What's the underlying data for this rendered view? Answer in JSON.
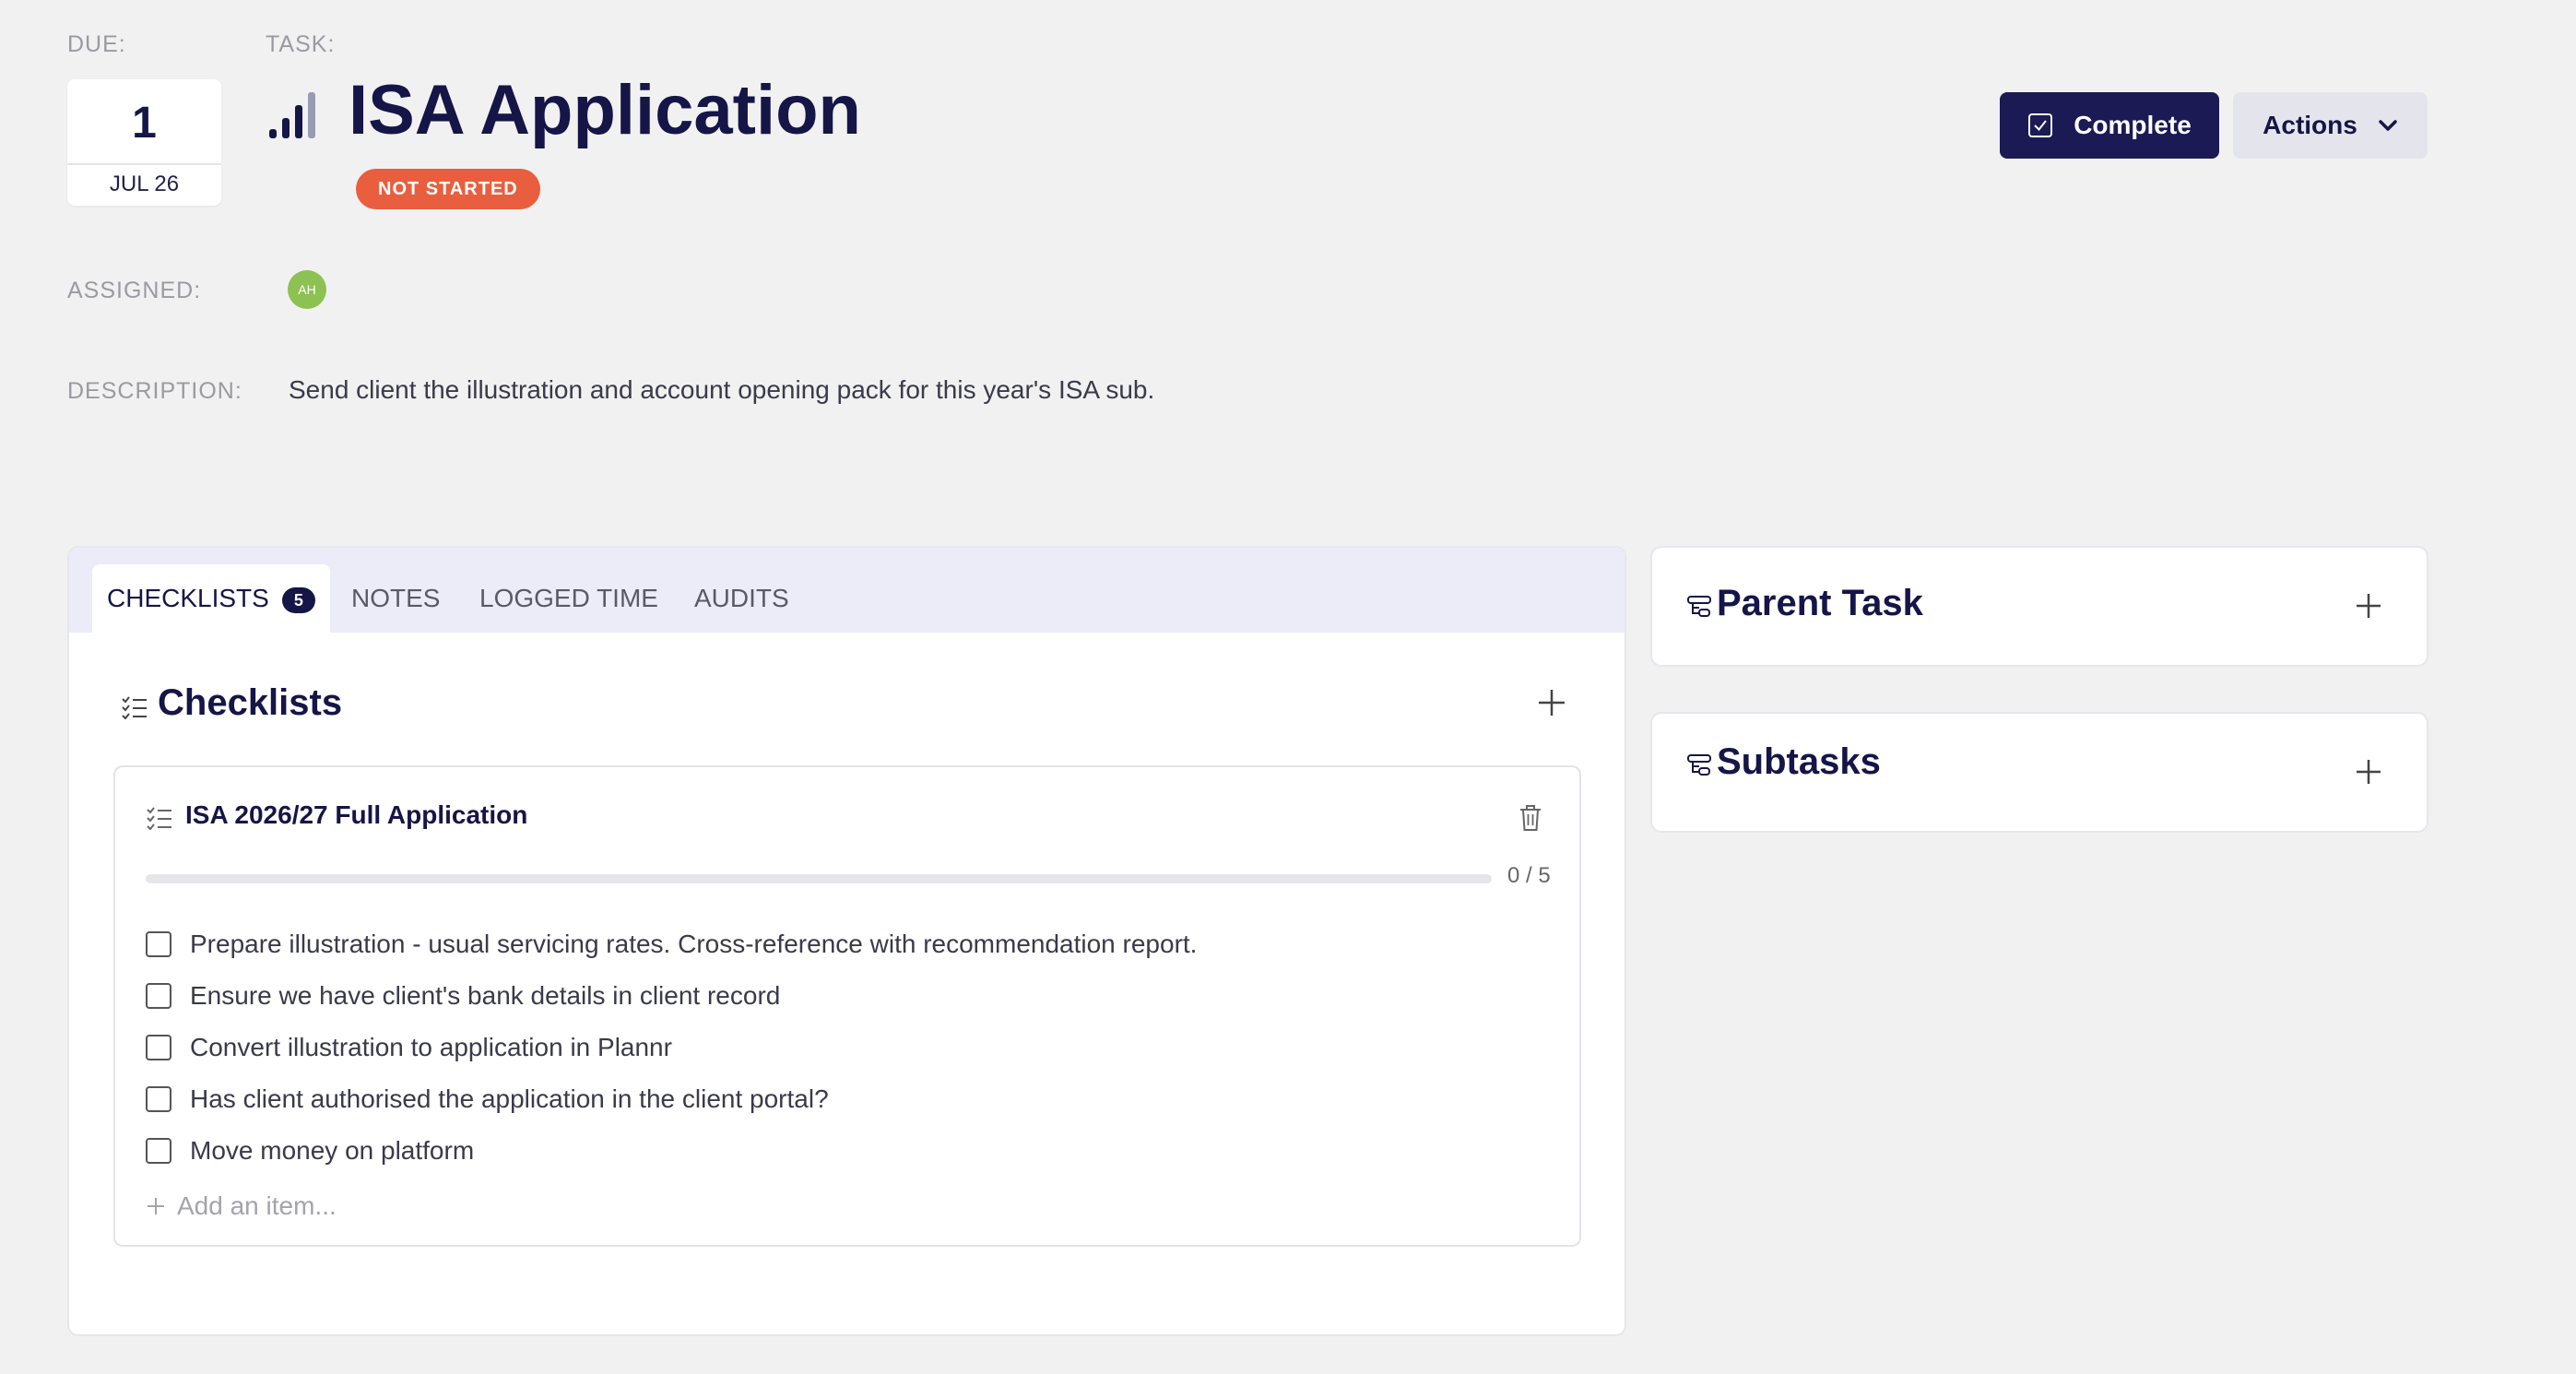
{
  "header": {
    "due_label": "DUE:",
    "task_label": "TASK:",
    "due_day": "1",
    "due_month": "JUL 26",
    "title": "ISA Application",
    "priority_icon": "signal-bars-icon",
    "status": "NOT STARTED"
  },
  "actions": {
    "complete_label": "Complete",
    "actions_label": "Actions"
  },
  "assigned": {
    "label": "ASSIGNED:",
    "avatar_initials": "AH"
  },
  "description": {
    "label": "DESCRIPTION:",
    "text": "Send client the illustration and account opening pack for this year's ISA sub."
  },
  "tabs": [
    {
      "label": "CHECKLISTS",
      "count": "5"
    },
    {
      "label": "NOTES"
    },
    {
      "label": "LOGGED TIME"
    },
    {
      "label": "AUDITS"
    }
  ],
  "checklists": {
    "title": "Checklists",
    "list": {
      "name": "ISA 2026/27 Full Application",
      "progress_text": "0 / 5",
      "progress_fraction": 0,
      "items": [
        "Prepare illustration - usual servicing rates. Cross-reference with recommendation report.",
        "Ensure we have client's bank details in client record",
        "Convert illustration to application in Plannr",
        "Has client authorised the application in the client portal?",
        "Move money on platform"
      ],
      "add_placeholder": "Add an item..."
    }
  },
  "parent_task": {
    "title": "Parent Task"
  },
  "subtasks": {
    "title": "Subtasks"
  },
  "colors": {
    "navy": "#1b1a55",
    "status_badge": "#e95e3e",
    "avatar": "#8dc152",
    "tab_bar": "#ececf8"
  }
}
